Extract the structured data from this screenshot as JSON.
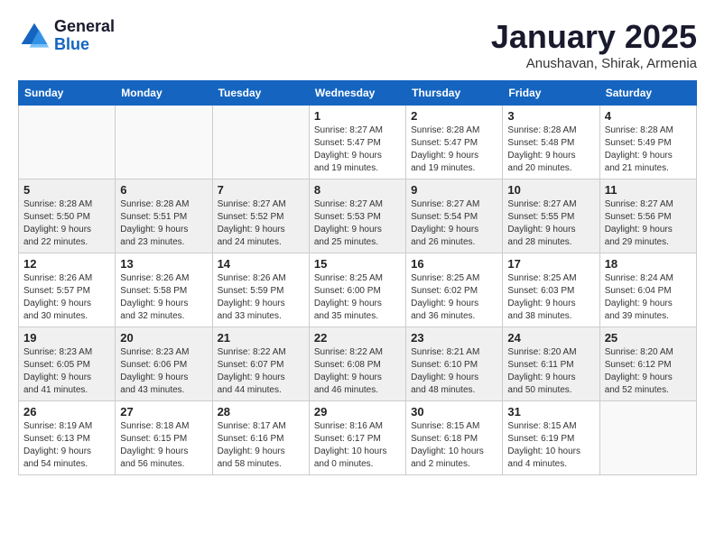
{
  "logo": {
    "line1": "General",
    "line2": "Blue"
  },
  "title": "January 2025",
  "subtitle": "Anushavan, Shirak, Armenia",
  "weekdays": [
    "Sunday",
    "Monday",
    "Tuesday",
    "Wednesday",
    "Thursday",
    "Friday",
    "Saturday"
  ],
  "weeks": [
    [
      {
        "day": "",
        "info": ""
      },
      {
        "day": "",
        "info": ""
      },
      {
        "day": "",
        "info": ""
      },
      {
        "day": "1",
        "info": "Sunrise: 8:27 AM\nSunset: 5:47 PM\nDaylight: 9 hours\nand 19 minutes."
      },
      {
        "day": "2",
        "info": "Sunrise: 8:28 AM\nSunset: 5:47 PM\nDaylight: 9 hours\nand 19 minutes."
      },
      {
        "day": "3",
        "info": "Sunrise: 8:28 AM\nSunset: 5:48 PM\nDaylight: 9 hours\nand 20 minutes."
      },
      {
        "day": "4",
        "info": "Sunrise: 8:28 AM\nSunset: 5:49 PM\nDaylight: 9 hours\nand 21 minutes."
      }
    ],
    [
      {
        "day": "5",
        "info": "Sunrise: 8:28 AM\nSunset: 5:50 PM\nDaylight: 9 hours\nand 22 minutes."
      },
      {
        "day": "6",
        "info": "Sunrise: 8:28 AM\nSunset: 5:51 PM\nDaylight: 9 hours\nand 23 minutes."
      },
      {
        "day": "7",
        "info": "Sunrise: 8:27 AM\nSunset: 5:52 PM\nDaylight: 9 hours\nand 24 minutes."
      },
      {
        "day": "8",
        "info": "Sunrise: 8:27 AM\nSunset: 5:53 PM\nDaylight: 9 hours\nand 25 minutes."
      },
      {
        "day": "9",
        "info": "Sunrise: 8:27 AM\nSunset: 5:54 PM\nDaylight: 9 hours\nand 26 minutes."
      },
      {
        "day": "10",
        "info": "Sunrise: 8:27 AM\nSunset: 5:55 PM\nDaylight: 9 hours\nand 28 minutes."
      },
      {
        "day": "11",
        "info": "Sunrise: 8:27 AM\nSunset: 5:56 PM\nDaylight: 9 hours\nand 29 minutes."
      }
    ],
    [
      {
        "day": "12",
        "info": "Sunrise: 8:26 AM\nSunset: 5:57 PM\nDaylight: 9 hours\nand 30 minutes."
      },
      {
        "day": "13",
        "info": "Sunrise: 8:26 AM\nSunset: 5:58 PM\nDaylight: 9 hours\nand 32 minutes."
      },
      {
        "day": "14",
        "info": "Sunrise: 8:26 AM\nSunset: 5:59 PM\nDaylight: 9 hours\nand 33 minutes."
      },
      {
        "day": "15",
        "info": "Sunrise: 8:25 AM\nSunset: 6:00 PM\nDaylight: 9 hours\nand 35 minutes."
      },
      {
        "day": "16",
        "info": "Sunrise: 8:25 AM\nSunset: 6:02 PM\nDaylight: 9 hours\nand 36 minutes."
      },
      {
        "day": "17",
        "info": "Sunrise: 8:25 AM\nSunset: 6:03 PM\nDaylight: 9 hours\nand 38 minutes."
      },
      {
        "day": "18",
        "info": "Sunrise: 8:24 AM\nSunset: 6:04 PM\nDaylight: 9 hours\nand 39 minutes."
      }
    ],
    [
      {
        "day": "19",
        "info": "Sunrise: 8:23 AM\nSunset: 6:05 PM\nDaylight: 9 hours\nand 41 minutes."
      },
      {
        "day": "20",
        "info": "Sunrise: 8:23 AM\nSunset: 6:06 PM\nDaylight: 9 hours\nand 43 minutes."
      },
      {
        "day": "21",
        "info": "Sunrise: 8:22 AM\nSunset: 6:07 PM\nDaylight: 9 hours\nand 44 minutes."
      },
      {
        "day": "22",
        "info": "Sunrise: 8:22 AM\nSunset: 6:08 PM\nDaylight: 9 hours\nand 46 minutes."
      },
      {
        "day": "23",
        "info": "Sunrise: 8:21 AM\nSunset: 6:10 PM\nDaylight: 9 hours\nand 48 minutes."
      },
      {
        "day": "24",
        "info": "Sunrise: 8:20 AM\nSunset: 6:11 PM\nDaylight: 9 hours\nand 50 minutes."
      },
      {
        "day": "25",
        "info": "Sunrise: 8:20 AM\nSunset: 6:12 PM\nDaylight: 9 hours\nand 52 minutes."
      }
    ],
    [
      {
        "day": "26",
        "info": "Sunrise: 8:19 AM\nSunset: 6:13 PM\nDaylight: 9 hours\nand 54 minutes."
      },
      {
        "day": "27",
        "info": "Sunrise: 8:18 AM\nSunset: 6:15 PM\nDaylight: 9 hours\nand 56 minutes."
      },
      {
        "day": "28",
        "info": "Sunrise: 8:17 AM\nSunset: 6:16 PM\nDaylight: 9 hours\nand 58 minutes."
      },
      {
        "day": "29",
        "info": "Sunrise: 8:16 AM\nSunset: 6:17 PM\nDaylight: 10 hours\nand 0 minutes."
      },
      {
        "day": "30",
        "info": "Sunrise: 8:15 AM\nSunset: 6:18 PM\nDaylight: 10 hours\nand 2 minutes."
      },
      {
        "day": "31",
        "info": "Sunrise: 8:15 AM\nSunset: 6:19 PM\nDaylight: 10 hours\nand 4 minutes."
      },
      {
        "day": "",
        "info": ""
      }
    ]
  ]
}
